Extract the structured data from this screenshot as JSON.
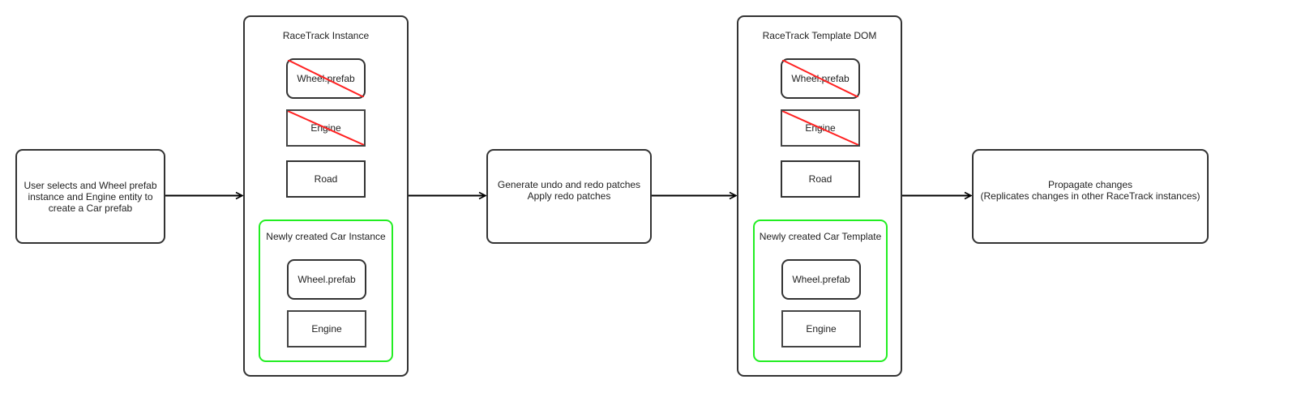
{
  "diagram": {
    "colors": {
      "stroke": "#333333",
      "group_stroke": "#22ee22",
      "strike": "#ff2222",
      "text": "#222222"
    },
    "start_node": {
      "text": "User selects and Wheel prefab\ninstance and Engine entity to\ncreate a Car prefab"
    },
    "instance_container": {
      "title": "RaceTrack Instance",
      "items": [
        {
          "label": "Wheel.prefab",
          "shape": "rounded",
          "struck_out": true
        },
        {
          "label": "Engine",
          "shape": "square",
          "struck_out": true
        },
        {
          "label": "Road",
          "shape": "square",
          "struck_out": false
        }
      ],
      "group": {
        "title": "Newly created Car Instance",
        "items": [
          {
            "label": "Wheel.prefab",
            "shape": "rounded"
          },
          {
            "label": "Engine",
            "shape": "square"
          }
        ]
      }
    },
    "patch_node": {
      "text": "Generate undo and redo patches\nApply redo patches"
    },
    "template_container": {
      "title": "RaceTrack Template DOM",
      "items": [
        {
          "label": "Wheel.prefab",
          "shape": "rounded",
          "struck_out": true
        },
        {
          "label": "Engine",
          "shape": "square",
          "struck_out": true
        },
        {
          "label": "Road",
          "shape": "square",
          "struck_out": false
        }
      ],
      "group": {
        "title": "Newly created Car Template",
        "items": [
          {
            "label": "Wheel.prefab",
            "shape": "rounded"
          },
          {
            "label": "Engine",
            "shape": "square"
          }
        ]
      }
    },
    "propagate_node": {
      "text": "Propagate changes\n(Replicates changes in other RaceTrack instances)"
    },
    "edges": [
      {
        "from": "start_node",
        "to": "instance_container"
      },
      {
        "from": "instance_container",
        "to": "patch_node"
      },
      {
        "from": "patch_node",
        "to": "template_container"
      },
      {
        "from": "template_container",
        "to": "propagate_node"
      }
    ]
  }
}
